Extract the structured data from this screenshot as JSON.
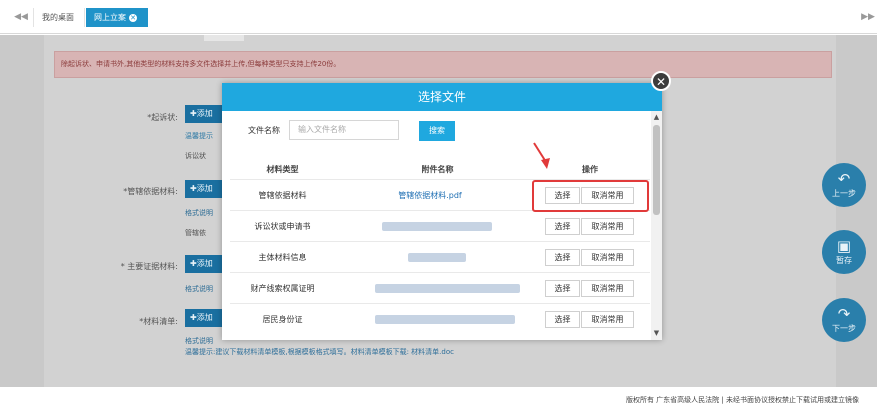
{
  "tabs": {
    "nav_left": "◀◀",
    "nav_right": "▶▶",
    "home": "我的桌面",
    "active": "网上立案",
    "active_close": "✕"
  },
  "page": {
    "alert": "除起诉状、申请书外,其他类型的材料支持多文件选择并上传,但每种类型只支持上传20份。",
    "labels": {
      "complaint": "*起诉状:",
      "jurisdiction": "*管辖依据材料:",
      "subject": "* 主要证据材料:",
      "materials": "*材料清单:"
    },
    "add_button": "✚添加",
    "bg_texts": {
      "t1": "温馨提示",
      "t2": "诉讼状",
      "t3": "格式说明",
      "t4": "管辖依",
      "t5": "格式说明",
      "t6": "格式说明"
    },
    "hint": "温馨提示:建议下载材料清单模板,根据模板格式填写。材料清单模板下载: 材料清单.doc"
  },
  "side_buttons": [
    {
      "icon": "↶",
      "label": "上一步"
    },
    {
      "icon": "▣",
      "label": "暂存"
    },
    {
      "icon": "↷",
      "label": "下一步"
    }
  ],
  "footer": "版权所有 广东省高级人民法院 | 未经书面协议授权禁止下载试用或建立镜像",
  "modal": {
    "title": "选择文件",
    "close": "✕",
    "search_label": "文件名称",
    "search_placeholder": "输入文件名称",
    "search_button": "搜索",
    "headers": {
      "type": "材料类型",
      "file": "附件名称",
      "ops": "操作"
    },
    "select_label": "选择",
    "cancel_label": "取消常用",
    "rows": [
      {
        "type": "管辖依据材料",
        "file": "管辖依据材料.pdf"
      },
      {
        "type": "诉讼状或申请书",
        "file": ""
      },
      {
        "type": "主体材料信息",
        "file": ""
      },
      {
        "type": "财产线索权属证明",
        "file": ""
      },
      {
        "type": "居民身份证",
        "file": ""
      }
    ]
  },
  "colors": {
    "accent": "#1fa8df",
    "tab_active": "#1f93c9",
    "highlight": "#e13a3a"
  }
}
